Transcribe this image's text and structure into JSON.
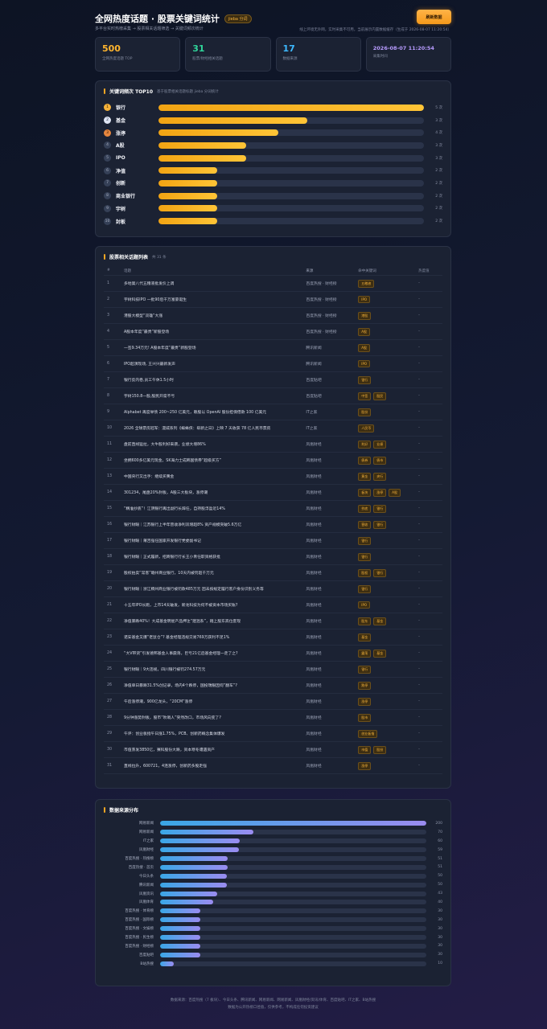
{
  "header": {
    "title": "全网热度话题 · 股票关键词统计",
    "badge": "jieba 分词",
    "refresh_label": "刷新数据",
    "subtitle": "多平台实时热榜采集 → 股票相关话题筛选 → 关键词频次统计",
    "hint": "线上环境无外网，实时采集不可用，当前展示内置数据缓存（生成于 2026-08-07 11:20:54）"
  },
  "stats": [
    {
      "value": "500",
      "label": "全网热度话题 TOP",
      "color": "orange"
    },
    {
      "value": "31",
      "label": "股票/财经相关话题",
      "color": "green"
    },
    {
      "value": "17",
      "label": "数据来源",
      "color": "blue"
    },
    {
      "value": "2026-08-07 11:20:54",
      "label": "采集时间",
      "color": "purple"
    }
  ],
  "keywords": {
    "title": "关键词频次 TOP10",
    "subtitle": "基于股票相关话题标题 jieba 分词统计",
    "items": [
      {
        "rank": "1",
        "name": "银行",
        "count": 5,
        "count_label": "5 次"
      },
      {
        "rank": "2",
        "name": "基金",
        "count": 3,
        "count_label": "3 次"
      },
      {
        "rank": "3",
        "name": "涨停",
        "count": 2,
        "count_label": "4 次"
      },
      {
        "rank": "4",
        "name": "A股",
        "count": 1,
        "count_label": "3 次"
      },
      {
        "rank": "5",
        "name": "IPO",
        "count": 1,
        "count_label": "3 次"
      },
      {
        "rank": "6",
        "name": "净值",
        "count": 1,
        "count_label": "2 次"
      },
      {
        "rank": "7",
        "name": "创新",
        "count": 1,
        "count_label": "2 次"
      },
      {
        "rank": "8",
        "name": "商业银行",
        "count": 1,
        "count_label": "2 次"
      },
      {
        "rank": "9",
        "name": "宇树",
        "count": 1,
        "count_label": "2 次"
      },
      {
        "rank": "10",
        "name": "封板",
        "count": 1,
        "count_label": "2 次"
      }
    ],
    "fill_fractions": [
      1.0,
      0.56,
      0.45,
      0.33,
      0.33,
      0.22,
      0.22,
      0.22,
      0.22,
      0.22
    ]
  },
  "table": {
    "title": "股票相关话题列表",
    "count_label": "共 31 条",
    "columns": [
      "#",
      "话题",
      "来源",
      "命中关键词",
      "热度值"
    ],
    "rows": [
      {
        "idx": "1",
        "title": "多地第八代五粮液批发价上调",
        "source": "百度热搜 · 财经榜",
        "tags": [
          "五粮液"
        ],
        "heat": "-"
      },
      {
        "idx": "2",
        "title": "宇树科技IPO 一批90后千万富豪诞生",
        "source": "百度热搜 · 财经榜",
        "tags": [
          "IPO"
        ],
        "heat": "-"
      },
      {
        "idx": "3",
        "title": "港股大模型“双雄”大涨",
        "source": "百度热搜 · 财经榜",
        "tags": [
          "港股"
        ],
        "heat": "-"
      },
      {
        "idx": "4",
        "title": "A股本年度“最贵”新股登场",
        "source": "百度热搜 · 财经榜",
        "tags": [
          "A股"
        ],
        "heat": "-"
      },
      {
        "idx": "5",
        "title": "一签9.34万元! A股本年度“最贵”新股登场",
        "source": "腾讯新闻",
        "tags": [
          "A股"
        ],
        "heat": "-"
      },
      {
        "idx": "6",
        "title": "IPO超演现场, 王兴兴最新发声",
        "source": "腾讯新闻",
        "tags": [
          "IPO"
        ],
        "heat": "-"
      },
      {
        "idx": "7",
        "title": "银行反内卷,员工午休1.5小时",
        "source": "百度贴吧",
        "tags": [
          "银行"
        ],
        "heat": "-"
      },
      {
        "idx": "8",
        "title": "宇树150.8一股,股民开席不亏",
        "source": "百度贴吧",
        "tags": [
          "中签",
          "股民"
        ],
        "heat": "-"
      },
      {
        "idx": "9",
        "title": "Alphabet 再度举债 200~250 亿美元，赖股以 OpenAI 股份担保借款 100 亿美元",
        "source": "IT之家",
        "tags": [
          "股份"
        ],
        "heat": "-"
      },
      {
        "idx": "10",
        "title": "2026 全球票房冠军：漫威系列《蜘蛛侠：崭新之日》上映 7 天收获 78 亿人民币票房",
        "source": "IT之家",
        "tags": [
          "人民币"
        ],
        "heat": "-"
      },
      {
        "idx": "11",
        "title": "盘前直线猛拉，大牛股利好来袭，业绩大增86%",
        "source": "凤凰财经",
        "tags": [
          "利好",
          "业绩"
        ],
        "heat": "-"
      },
      {
        "idx": "12",
        "title": "坐拥600多亿美元现金，SK海力士成韩国债券“超级买方”",
        "source": "凤凰财经",
        "tags": [
          "债券",
          "债市"
        ],
        "heat": "-"
      },
      {
        "idx": "13",
        "title": "中国央行又出手：继续买黄金",
        "source": "凤凰财经",
        "tags": [
          "黄金",
          "央行"
        ],
        "heat": "-"
      },
      {
        "idx": "14",
        "title": "301234，尾盘20%封板，A股三大板块，涨停潮",
        "source": "凤凰财经",
        "tags": [
          "板块",
          "涨停",
          "A股"
        ],
        "heat": "-"
      },
      {
        "idx": "15",
        "title": "“精准抄底”！江阴银行再出副行长辞任，自持股浮盈近14%",
        "source": "凤凰财经",
        "tags": [
          "抄底",
          "银行"
        ],
        "heat": "-"
      },
      {
        "idx": "16",
        "title": "银行财眼｜江苏银行上半年营收净利双增超8% 资产规模突破5.6万亿",
        "source": "凤凰财经",
        "tags": [
          "营收",
          "银行"
        ],
        "heat": "-"
      },
      {
        "idx": "17",
        "title": "银行财眼｜莆吉强任国家开发银行党委副书记",
        "source": "凤凰财经",
        "tags": [
          "银行"
        ],
        "heat": "-"
      },
      {
        "idx": "18",
        "title": "银行财眼｜正式履新，招商银行行长王小青任职资格获批",
        "source": "凤凰财经",
        "tags": [
          "银行"
        ],
        "heat": "-"
      },
      {
        "idx": "19",
        "title": "股权拍卖“常客”赣州商业银行，10天内被罚超千万元",
        "source": "凤凰财经",
        "tags": [
          "股权",
          "银行"
        ],
        "heat": "-"
      },
      {
        "idx": "20",
        "title": "银行财眼｜浙江稠州商业银行被罚款485万元 因未按规定履行客户身份识别义务等",
        "source": "凤凰财经",
        "tags": [
          "银行"
        ],
        "heat": "-"
      },
      {
        "idx": "21",
        "title": "十五年IPO长跑，上市14天破发，新龙科技为何不被资本市场买账?",
        "source": "凤凰财经",
        "tags": [
          "IPO"
        ],
        "heat": "-"
      },
      {
        "idx": "22",
        "title": "净值暴跌40%！大成基金明星产品押注“建混系”，踏上股东高位套现",
        "source": "凤凰财经",
        "tags": [
          "股东",
          "基金"
        ],
        "heat": "-"
      },
      {
        "idx": "23",
        "title": "诺安基金又爆“老鼠仓”? 基金经理违规交易769万获利不足1%",
        "source": "凤凰财经",
        "tags": [
          "基金"
        ],
        "heat": "-"
      },
      {
        "idx": "24",
        "title": "“大V带货”引发德邦基金人事震荡，巨亏21亿后基金经理一走了之?",
        "source": "凤凰财经",
        "tags": [
          "震荡",
          "基金"
        ],
        "heat": "-"
      },
      {
        "idx": "25",
        "title": "银行财眼｜9大违规，四川银行被罚274.57万元",
        "source": "凤凰财经",
        "tags": [
          "银行"
        ],
        "heat": "-"
      },
      {
        "idx": "26",
        "title": "净值单日暴跌31.5%创记录，场内4个跌停，国投瑞银因何“翻车”?",
        "source": "凤凰财经",
        "tags": [
          "跌停"
        ],
        "heat": "-"
      },
      {
        "idx": "27",
        "title": "午后涨停潮，900亿龙头，“20CM”涨停",
        "source": "凤凰财经",
        "tags": [
          "涨停"
        ],
        "heat": "-"
      },
      {
        "idx": "28",
        "title": "9分钟涨势封板，股市“吹哨人”突然改口，市场风向变了?",
        "source": "凤凰财经",
        "tags": [
          "股市"
        ],
        "heat": "-"
      },
      {
        "idx": "29",
        "title": "午评：创业板指午日涨1.75%，PCB、创新药概念集体爆发",
        "source": "凤凰财经",
        "tags": [
          "创业板指"
        ],
        "heat": "-"
      },
      {
        "idx": "30",
        "title": "市值蒸发3850亿，赛科股份大跌，资本寒冬遭遇资产",
        "source": "凤凰财经",
        "tags": [
          "市值",
          "股份"
        ],
        "heat": "-"
      },
      {
        "idx": "31",
        "title": "直线拉升，600721，4连涨停，创新药多股走强",
        "source": "凤凰财经",
        "tags": [
          "涨停"
        ],
        "heat": "-"
      }
    ]
  },
  "sources": {
    "title": "数据来源分布",
    "items": [
      {
        "name": "网易新闻",
        "count": 200
      },
      {
        "name": "网易新闻",
        "count": 70
      },
      {
        "name": "IT之家",
        "count": 60
      },
      {
        "name": "凤凰财经",
        "count": 59
      },
      {
        "name": "百度热搜 · 热搜榜",
        "count": 51
      },
      {
        "name": "百度热搜 · 首页",
        "count": 51
      },
      {
        "name": "今日头条",
        "count": 50
      },
      {
        "name": "腾讯新闻",
        "count": 50
      },
      {
        "name": "凤凰资讯",
        "count": 43
      },
      {
        "name": "凤凰体育",
        "count": 40
      },
      {
        "name": "百度热搜 · 体育榜",
        "count": 30
      },
      {
        "name": "百度热搜 · 国际榜",
        "count": 30
      },
      {
        "name": "百度热搜 · 文娱榜",
        "count": 30
      },
      {
        "name": "百度热搜 · 民生榜",
        "count": 30
      },
      {
        "name": "百度热搜 · 财经榜",
        "count": 30
      },
      {
        "name": "百度贴吧",
        "count": 30
      },
      {
        "name": "B站热搜",
        "count": 10
      }
    ],
    "max": 200
  },
  "footer": {
    "line1": "数据来源：百度热搜（7 板块）、今日头条、腾讯新闻、网易新闻、网易新闻、凤凰财经/资讯/体育、百度贴吧、IT之家、B站热搜",
    "line2": "数据为公开热榜口径值，仅供参考，不构成任何投资建议"
  }
}
